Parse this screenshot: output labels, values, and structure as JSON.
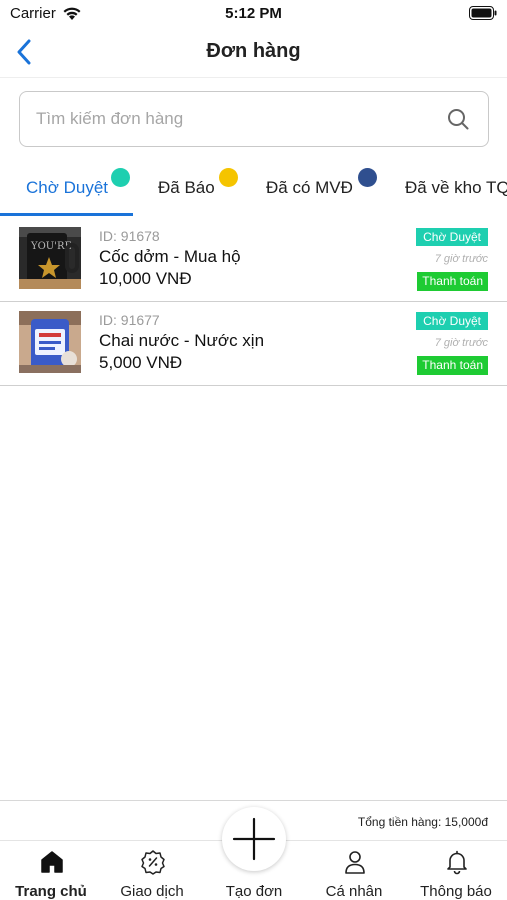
{
  "status_bar": {
    "carrier": "Carrier",
    "time": "5:12 PM"
  },
  "nav": {
    "title": "Đơn hàng",
    "back_icon": "chevron-left-icon"
  },
  "search": {
    "placeholder": "Tìm kiếm đơn hàng",
    "value": "",
    "icon": "search-icon"
  },
  "tabs": [
    {
      "label": "Chờ Duyệt",
      "active": true,
      "dot_color": "#1ecfb0"
    },
    {
      "label": "Đã Báo",
      "active": false,
      "dot_color": "#f5c400"
    },
    {
      "label": "Đã có MVĐ",
      "active": false,
      "dot_color": "#2f4f8f"
    },
    {
      "label": "Đã về kho TQ",
      "active": false
    }
  ],
  "colors": {
    "accent": "#1a73d9",
    "status_badge": "#1ecfb0",
    "pay_button": "#1ecb33"
  },
  "orders": [
    {
      "id": "ID: 91678",
      "name": "Cốc dởm - Mua hộ",
      "price": "10,000 VNĐ",
      "status": "Chờ Duyệt",
      "time": "7 giờ trước",
      "action": "Thanh toán"
    },
    {
      "id": "ID: 91677",
      "name": "Chai nước - Nước xịn",
      "price": "5,000 VNĐ",
      "status": "Chờ Duyệt",
      "time": "7 giờ trước",
      "action": "Thanh toán"
    }
  ],
  "footer": {
    "total": "Tổng tiền hàng: 15,000đ"
  },
  "tab_bar": {
    "items": [
      {
        "label": "Trang chủ",
        "icon": "home-icon",
        "active": true
      },
      {
        "label": "Giao dịch",
        "icon": "discount-badge-icon",
        "active": false
      },
      {
        "label": "Tạo đơn",
        "icon": "plus-icon",
        "active": false
      },
      {
        "label": "Cá nhân",
        "icon": "user-icon",
        "active": false
      },
      {
        "label": "Thông báo",
        "icon": "bell-icon",
        "active": false
      }
    ]
  }
}
